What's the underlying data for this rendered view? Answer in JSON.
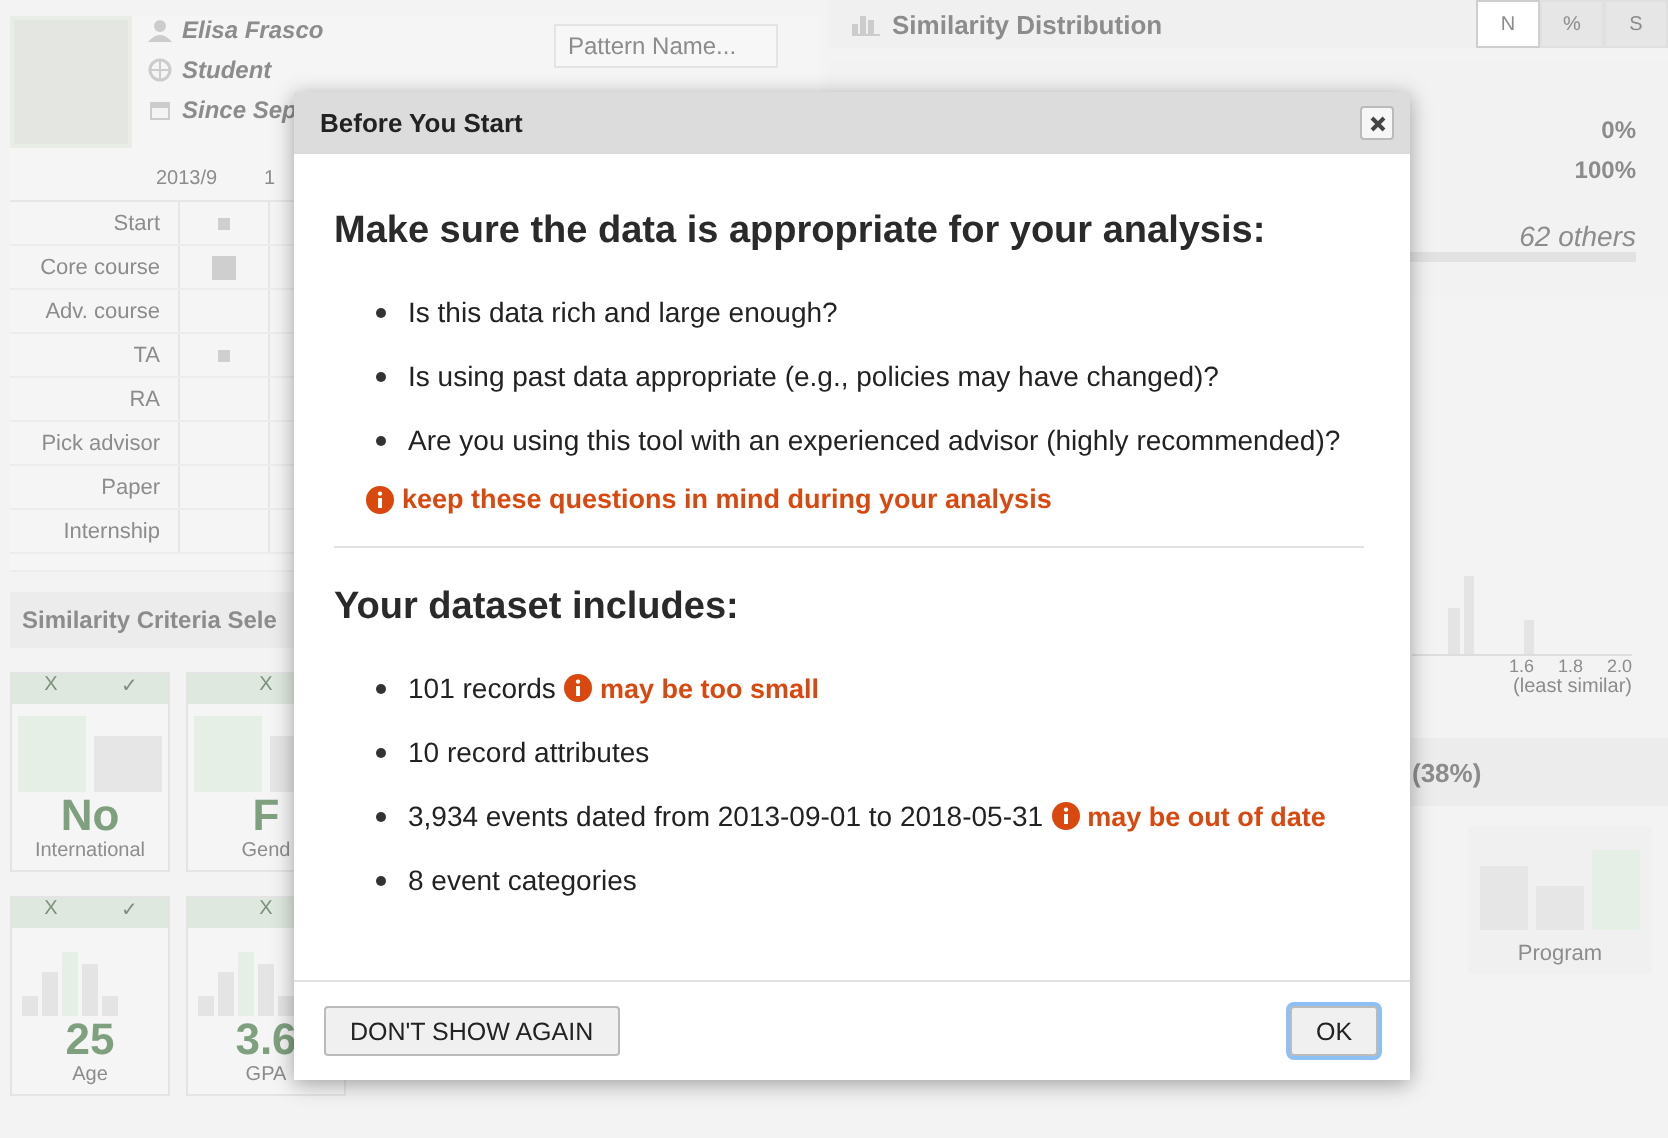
{
  "background": {
    "profile": {
      "name": "Elisa Frasco",
      "role": "Student",
      "since": "Since Sep"
    },
    "pattern_field": {
      "placeholder": "Pattern Name..."
    },
    "timeline": {
      "ticks": [
        "2013/9",
        "1"
      ],
      "rows": [
        {
          "label": "Start",
          "has_event": true,
          "large": false
        },
        {
          "label": "Core course",
          "has_event": true,
          "large": true
        },
        {
          "label": "Adv. course",
          "has_event": false
        },
        {
          "label": "TA",
          "has_event": true,
          "large": false
        },
        {
          "label": "RA",
          "has_event": false
        },
        {
          "label": "Pick advisor",
          "has_event": false
        },
        {
          "label": "Paper",
          "has_event": false
        },
        {
          "label": "Internship",
          "has_event": false
        }
      ]
    },
    "criteria": {
      "title": "Similarity Criteria Sele",
      "cards": [
        {
          "kind": "category",
          "header": [
            "X",
            "✓"
          ],
          "value": "No",
          "label": "International"
        },
        {
          "kind": "category",
          "header": [
            "X"
          ],
          "value": "F",
          "label": "Gend"
        },
        {
          "kind": "numeric",
          "header": [
            "X",
            "✓"
          ],
          "value": "25",
          "label": "Age"
        },
        {
          "kind": "numeric",
          "header": [
            "X"
          ],
          "value": "3.6",
          "label": "GPA"
        }
      ]
    },
    "distribution": {
      "title": "Similarity Distribution",
      "toggles": [
        {
          "label": "N",
          "selected": true
        },
        {
          "label": "%",
          "selected": false
        },
        {
          "label": "S",
          "selected": false
        }
      ],
      "percentages": [
        "0%",
        "100%"
      ],
      "others": "62 others",
      "axis_ticks": [
        "1.6",
        "1.8",
        "2.0"
      ],
      "axis_label": "(least similar)"
    },
    "group": {
      "title": "(38%)",
      "cards": [
        {
          "label": "Program"
        }
      ]
    }
  },
  "dialog": {
    "title": "Before You Start",
    "heading": "Make sure the data is appropriate for your analysis:",
    "questions": [
      "Is this data rich and large enough?",
      "Is using past data appropriate (e.g., policies may have changed)?",
      "Are you using this tool with an experienced advisor (highly recommended)?"
    ],
    "reminder": "keep these questions in mind during your analysis",
    "dataset_heading": "Your dataset includes:",
    "dataset_items": [
      {
        "text": "101 records",
        "warning": "may be too small"
      },
      {
        "text": "10 record attributes"
      },
      {
        "text": "3,934 events dated from 2013-09-01 to 2018-05-31",
        "warning": "may be out of date"
      },
      {
        "text": "8 event categories"
      }
    ],
    "buttons": [
      {
        "label": "DON'T SHOW AGAIN",
        "focused": false
      },
      {
        "label": "OK",
        "focused": true
      }
    ]
  }
}
